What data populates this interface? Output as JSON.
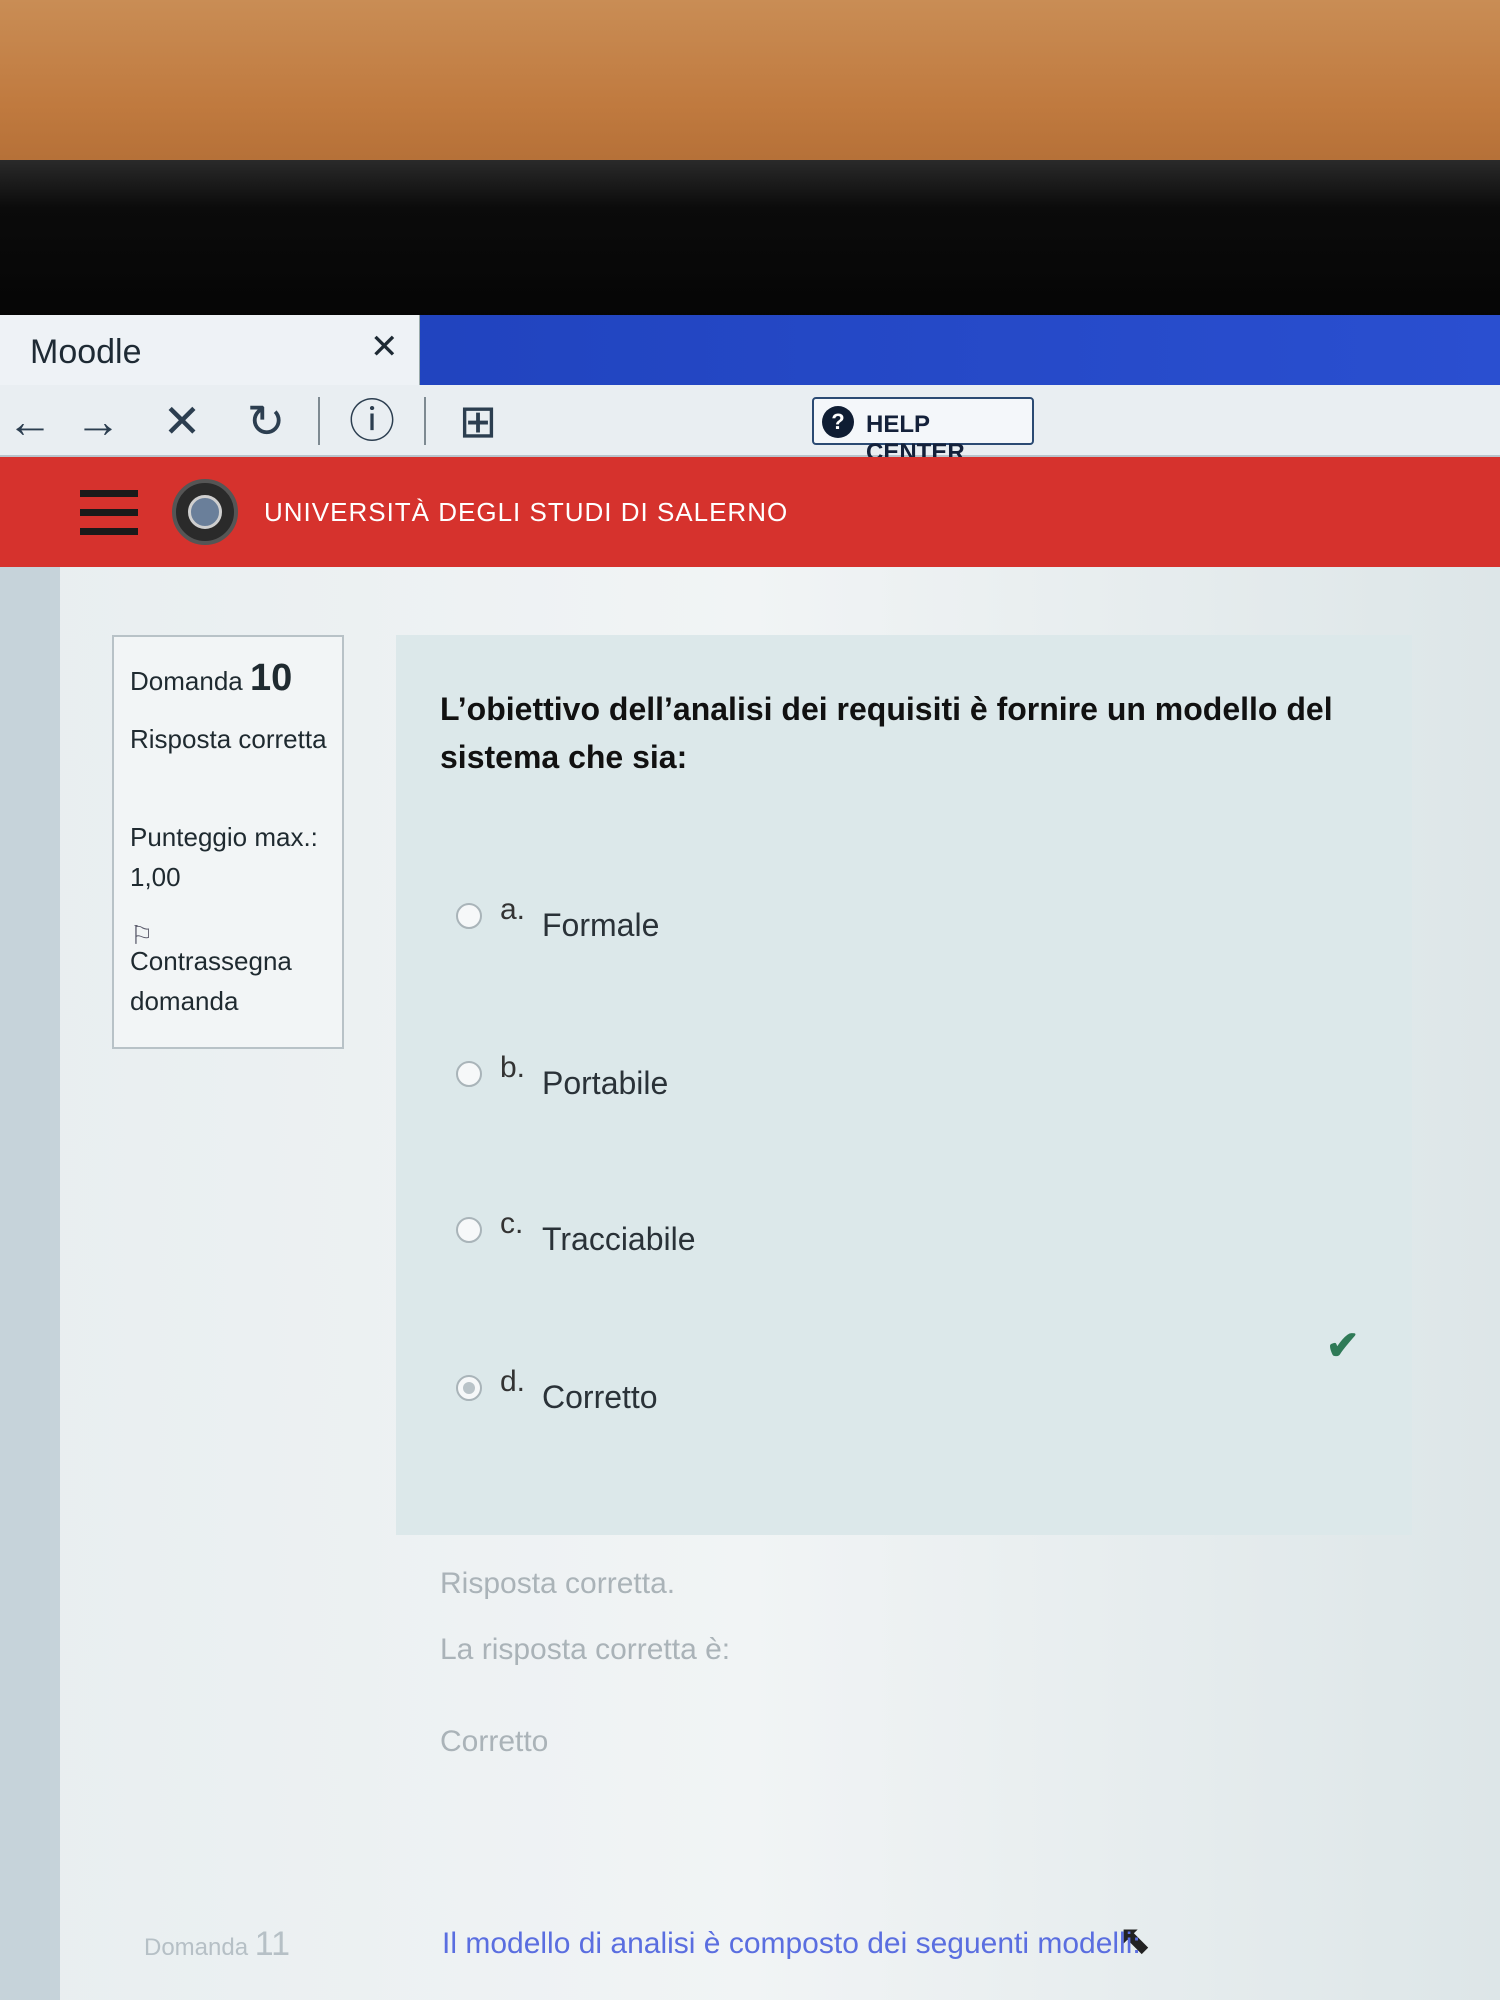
{
  "browser": {
    "tab_title": "Moodle",
    "tab_close": "✕",
    "nav": {
      "back": "←",
      "forward": "→",
      "stop": "✕",
      "reload": "↻",
      "info": "ⓘ",
      "page": "⊞"
    },
    "help_icon": "?",
    "help_label": "HELP CENTER"
  },
  "header": {
    "university": "UNIVERSITÀ DEGLI STUDI DI SALERNO"
  },
  "question_info": {
    "label": "Domanda",
    "number": "10",
    "state": "Risposta corretta",
    "grade": "Punteggio max.: 1,00",
    "flag_icon": "⚐",
    "flag_label": "Contrassegna domanda"
  },
  "question": {
    "text": "L’obiettivo dell’analisi dei requisiti è fornire un modello del sistema che sia:",
    "options": [
      {
        "letter": "a.",
        "label": "Formale",
        "selected": false
      },
      {
        "letter": "b.",
        "label": "Portabile",
        "selected": false
      },
      {
        "letter": "c.",
        "label": "Tracciabile",
        "selected": false
      },
      {
        "letter": "d.",
        "label": "Corretto",
        "selected": true
      }
    ],
    "correct_tick": "✔"
  },
  "feedback": {
    "state": "Risposta corretta.",
    "right_answer_intro": "La risposta corretta è:",
    "right_answer": "Corretto"
  },
  "next": {
    "label": "Domanda",
    "number": "11",
    "text": "Il modello di analisi è composto dei seguenti modelli:"
  },
  "colors": {
    "header_red": "#d6322d",
    "tab_blue": "#2a4fd0",
    "tick_green": "#2f7a57"
  }
}
